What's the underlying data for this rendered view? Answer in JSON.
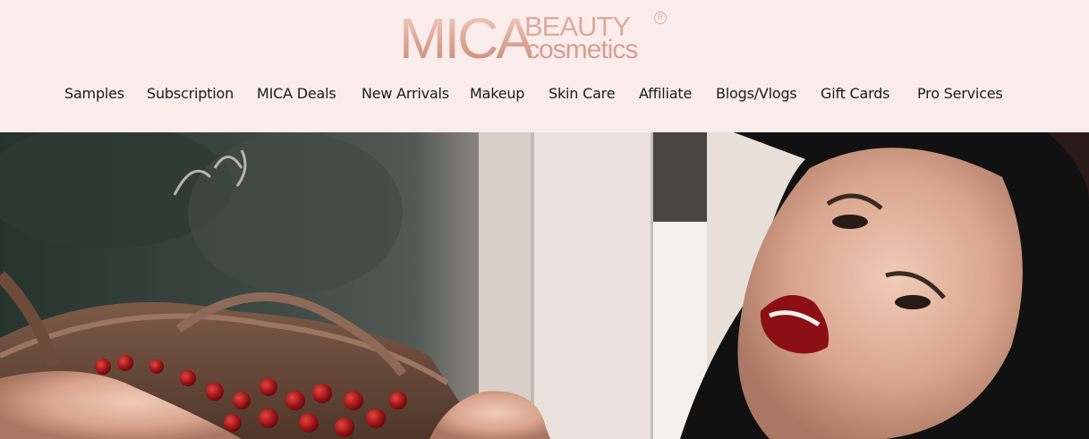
{
  "logo": {
    "mica": "MICA",
    "beauty": "BEAUTY",
    "cosmetics": "cosmetics",
    "registered": "R"
  },
  "nav": {
    "items": [
      {
        "label": "Samples"
      },
      {
        "label": "Subscription"
      },
      {
        "label": "MICA Deals"
      },
      {
        "label": "New Arrivals"
      },
      {
        "label": "Makeup"
      },
      {
        "label": "Skin Care"
      },
      {
        "label": "Affiliate"
      },
      {
        "label": "Blogs/Vlogs"
      },
      {
        "label": "Gift Cards"
      },
      {
        "label": "Pro Services"
      }
    ]
  },
  "colors": {
    "header_bg": "#fbecec",
    "logo_rose_gold": "#dcab99",
    "nav_text": "#1b1b1b"
  }
}
